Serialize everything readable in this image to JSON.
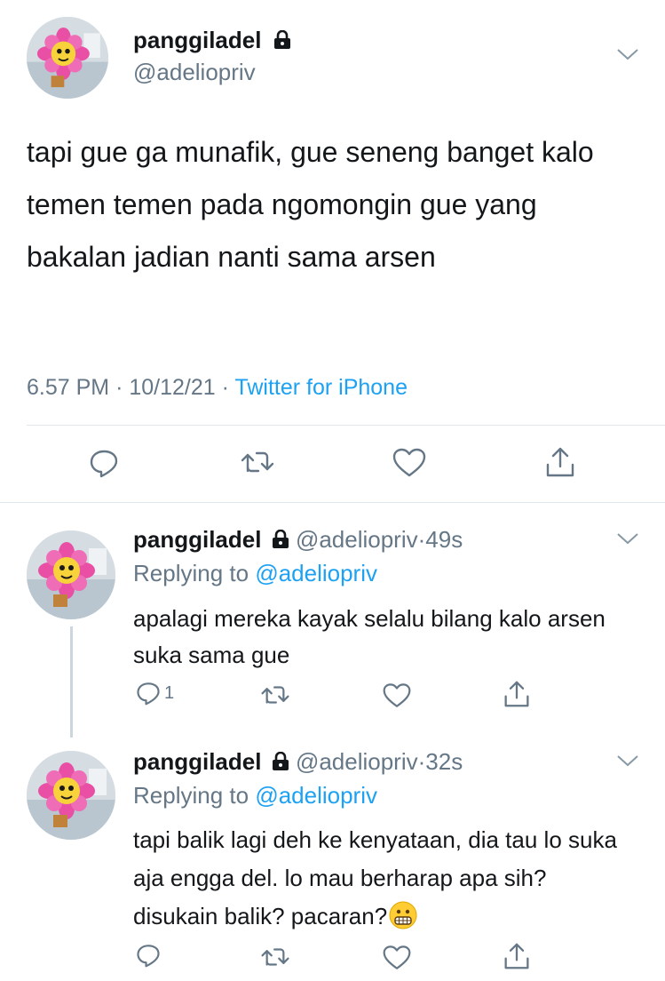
{
  "main_tweet": {
    "display_name": "panggiladel",
    "handle": "@adeliopriv",
    "text": "tapi gue ga munafik, gue seneng banget kalo temen temen pada ngomongin gue yang bakalan jadian nanti sama arsen",
    "time": "6.57 PM",
    "date": "10/12/21",
    "separator": "·",
    "source": "Twitter for iPhone"
  },
  "replies": [
    {
      "display_name": "panggiladel",
      "handle": "@adeliopriv",
      "age": "49s",
      "replying_label": "Replying to",
      "replying_handle": "@adeliopriv",
      "text": "apalagi mereka kayak selalu bilang kalo arsen suka sama gue",
      "reply_count": "1"
    },
    {
      "display_name": "panggiladel",
      "handle": "@adeliopriv",
      "age": "32s",
      "replying_label": "Replying to",
      "replying_handle": "@adeliopriv",
      "text": "tapi balik lagi deh ke kenyataan, dia tau lo suka aja engga del. lo mau berharap apa sih? disukain balik? pacaran?",
      "emoji": "grimacing-face",
      "reply_count": ""
    }
  ],
  "colors": {
    "link": "#1da1f2",
    "muted": "#657786",
    "text": "#14171a",
    "divider": "#e1e8ed"
  }
}
